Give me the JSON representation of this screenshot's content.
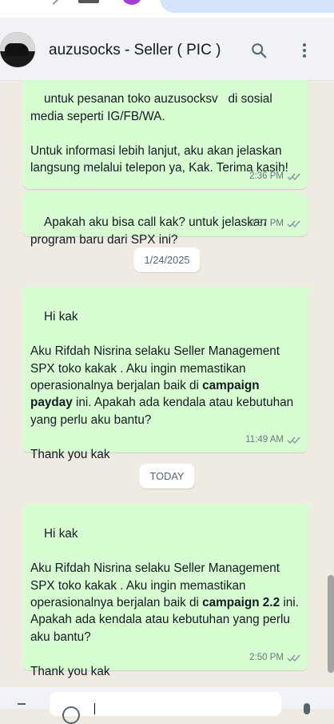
{
  "header": {
    "contact_name": "auzusocks - Seller ( PIC )"
  },
  "messages": [
    {
      "text": "untuk pesanan toko auzusocksv   di sosial media seperti IG/FB/WA.\n\nUntuk informasi lebih lanjut, aku akan jelaskan langsung melalui telepon ya, Kak. Terima kasih!",
      "time": "2:36 PM"
    },
    {
      "text": "Apakah aku bisa call kak? untuk jelaskan program baru dari SPX ini?",
      "time": "2:37 PM"
    },
    {
      "text_intro": "Hi kak\n\nAku Rifdah Nisrina selaku Seller Management SPX toko kakak . Aku ingin memastikan operasionalnya berjalan baik di ",
      "text_bold": "campaign payday",
      "text_outro": " ini. Apakah ada kendala atau kebutuhan yang perlu aku bantu?\n\nThank you kak",
      "time": "11:49 AM"
    },
    {
      "text_intro": "Hi kak\n\nAku Rifdah Nisrina selaku Seller Management SPX toko kakak . Aku ingin memastikan operasionalnya berjalan baik di ",
      "text_bold": "campaign 2.2",
      "text_outro": " ini. Apakah ada kendala atau kebutuhan yang perlu aku bantu?\n\nThank you kak",
      "time": "2:50 PM"
    }
  ],
  "dates": [
    "1/24/2025",
    "TODAY"
  ],
  "colors": {
    "outgoing_bubble": "#d9fdd3",
    "chat_background": "#efeae2",
    "read_ticks": "#8696a0"
  }
}
